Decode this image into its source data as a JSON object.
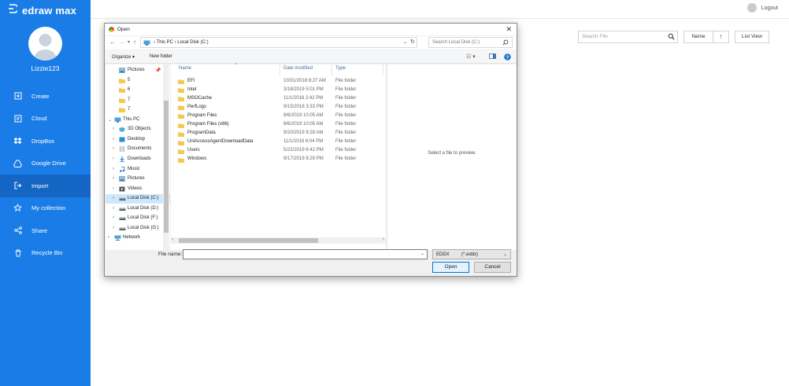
{
  "app": {
    "brand": "edraw max",
    "username": "Lizzie123",
    "logout_label": "Logout"
  },
  "sidebar": {
    "items": [
      {
        "label": "Create",
        "icon": "create-icon"
      },
      {
        "label": "Cloud",
        "icon": "cloud-icon"
      },
      {
        "label": "DropBox",
        "icon": "dropbox-icon"
      },
      {
        "label": "Google Drive",
        "icon": "google-drive-icon"
      },
      {
        "label": "Import",
        "icon": "import-icon",
        "active": true
      },
      {
        "label": "My collection",
        "icon": "star-icon"
      },
      {
        "label": "Share",
        "icon": "share-icon"
      },
      {
        "label": "Recycle Bin",
        "icon": "trash-icon"
      }
    ]
  },
  "toolbar": {
    "search_placeholder": "Search File",
    "sort_label": "Name",
    "sort_direction": "↑",
    "view_label": "List View"
  },
  "dialog": {
    "title": "Open",
    "breadcrumb": [
      "This PC",
      "Local Disk (C:)"
    ],
    "search_placeholder": "Search Local Disk (C:)",
    "organize_label": "Organize ▾",
    "new_folder_label": "New folder",
    "columns": {
      "name": "Name",
      "date": "Date modified",
      "type": "Type"
    },
    "tree": [
      {
        "label": "Pictures",
        "kind": "pictures",
        "indent": 1,
        "pinned": true
      },
      {
        "label": "5",
        "kind": "folder",
        "indent": 1
      },
      {
        "label": "6",
        "kind": "folder",
        "indent": 1
      },
      {
        "label": "7",
        "kind": "folder",
        "indent": 1
      },
      {
        "label": "7",
        "kind": "folder",
        "indent": 1
      },
      {
        "label": "This PC",
        "kind": "pc",
        "indent": 0,
        "expanded": true
      },
      {
        "label": "3D Objects",
        "kind": "objects",
        "indent": 1
      },
      {
        "label": "Desktop",
        "kind": "desktop",
        "indent": 1
      },
      {
        "label": "Documents",
        "kind": "documents",
        "indent": 1
      },
      {
        "label": "Downloads",
        "kind": "downloads",
        "indent": 1
      },
      {
        "label": "Music",
        "kind": "music",
        "indent": 1
      },
      {
        "label": "Pictures",
        "kind": "pictures",
        "indent": 1
      },
      {
        "label": "Videos",
        "kind": "videos",
        "indent": 1
      },
      {
        "label": "Local Disk (C:)",
        "kind": "disk",
        "indent": 1,
        "selected": true
      },
      {
        "label": "Local Disk (D:)",
        "kind": "disk",
        "indent": 1
      },
      {
        "label": "Local Disk (F:)",
        "kind": "disk",
        "indent": 1
      },
      {
        "label": "Local Disk (G:)",
        "kind": "disk",
        "indent": 1
      },
      {
        "label": "Network",
        "kind": "network",
        "indent": 0
      }
    ],
    "files": [
      {
        "name": "EFI",
        "date": "10/31/2018 8:27 AM",
        "type": "File folder"
      },
      {
        "name": "Intel",
        "date": "3/18/2019 5:01 PM",
        "type": "File folder"
      },
      {
        "name": "MSOCache",
        "date": "11/1/2018 2:42 PM",
        "type": "File folder"
      },
      {
        "name": "PerfLogs",
        "date": "9/15/2018 3:33 PM",
        "type": "File folder"
      },
      {
        "name": "Program Files",
        "date": "8/6/2019 10:05 AM",
        "type": "File folder"
      },
      {
        "name": "Program Files (x86)",
        "date": "8/6/2019 10:05 AM",
        "type": "File folder"
      },
      {
        "name": "ProgramData",
        "date": "9/20/2019 9:28 AM",
        "type": "File folder"
      },
      {
        "name": "UniAccessAgentDownloadData",
        "date": "11/1/2018 6:04 PM",
        "type": "File folder"
      },
      {
        "name": "Users",
        "date": "5/22/2019 6:42 PM",
        "type": "File folder"
      },
      {
        "name": "Windows",
        "date": "9/17/2019 8:29 PM",
        "type": "File folder"
      }
    ],
    "preview_message": "Select a file to preview.",
    "filename_label": "File name:",
    "filename_value": "",
    "filetype": {
      "name": "EDDX",
      "pattern": "(*.eddx)"
    },
    "open_label": "Open",
    "cancel_label": "Cancel"
  },
  "colors": {
    "sidebar": "#1a7ce6",
    "sidebar_active": "#1566c4",
    "selection": "#cce8ff",
    "folder": "#f7d774"
  }
}
